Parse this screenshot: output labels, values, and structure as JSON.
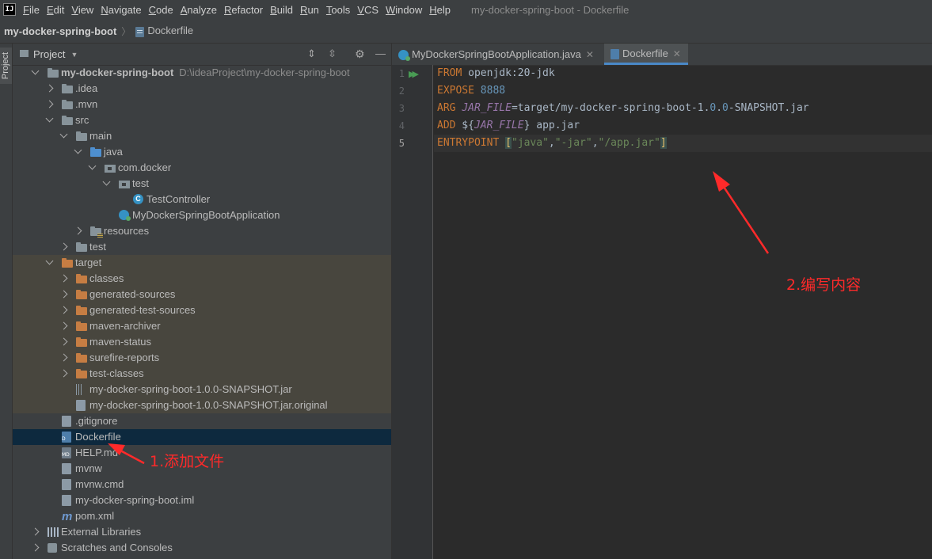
{
  "menu": {
    "logo": "IJ",
    "items": [
      "File",
      "Edit",
      "View",
      "Navigate",
      "Code",
      "Analyze",
      "Refactor",
      "Build",
      "Run",
      "Tools",
      "VCS",
      "Window",
      "Help"
    ],
    "window_title": "my-docker-spring-boot - Dockerfile"
  },
  "navbar": {
    "project": "my-docker-spring-boot",
    "file": "Dockerfile"
  },
  "side_tab": "Project",
  "project_panel": {
    "title": "Project"
  },
  "tree": [
    {
      "label": "my-docker-spring-boot",
      "path": "D:\\ideaProject\\my-docker-spring-boot",
      "level": 0,
      "arrow": "down",
      "icon": "module-folder-icon",
      "bold": true
    },
    {
      "label": ".idea",
      "level": 1,
      "arrow": "right",
      "icon": "folder-icon"
    },
    {
      "label": ".mvn",
      "level": 1,
      "arrow": "right",
      "icon": "folder-icon"
    },
    {
      "label": "src",
      "level": 1,
      "arrow": "down",
      "icon": "folder-icon"
    },
    {
      "label": "main",
      "level": 2,
      "arrow": "down",
      "icon": "folder-icon"
    },
    {
      "label": "java",
      "level": 3,
      "arrow": "down",
      "icon": "source-folder-icon"
    },
    {
      "label": "com.docker",
      "level": 4,
      "arrow": "down",
      "icon": "package-icon"
    },
    {
      "label": "test",
      "level": 5,
      "arrow": "down",
      "icon": "package-icon"
    },
    {
      "label": "TestController",
      "level": 6,
      "arrow": "",
      "icon": "class-icon"
    },
    {
      "label": "MyDockerSpringBootApplication",
      "level": 5,
      "arrow": "",
      "icon": "spring-app-class-icon"
    },
    {
      "label": "resources",
      "level": 3,
      "arrow": "right",
      "icon": "resources-folder-icon"
    },
    {
      "label": "test",
      "level": 2,
      "arrow": "right",
      "icon": "folder-icon"
    },
    {
      "label": "target",
      "level": 1,
      "arrow": "down",
      "icon": "excluded-folder-icon",
      "tinted": true
    },
    {
      "label": "classes",
      "level": 2,
      "arrow": "right",
      "icon": "excluded-folder-icon",
      "tinted": true
    },
    {
      "label": "generated-sources",
      "level": 2,
      "arrow": "right",
      "icon": "excluded-folder-icon",
      "tinted": true
    },
    {
      "label": "generated-test-sources",
      "level": 2,
      "arrow": "right",
      "icon": "excluded-folder-icon",
      "tinted": true
    },
    {
      "label": "maven-archiver",
      "level": 2,
      "arrow": "right",
      "icon": "excluded-folder-icon",
      "tinted": true
    },
    {
      "label": "maven-status",
      "level": 2,
      "arrow": "right",
      "icon": "excluded-folder-icon",
      "tinted": true
    },
    {
      "label": "surefire-reports",
      "level": 2,
      "arrow": "right",
      "icon": "excluded-folder-icon",
      "tinted": true
    },
    {
      "label": "test-classes",
      "level": 2,
      "arrow": "right",
      "icon": "excluded-folder-icon",
      "tinted": true
    },
    {
      "label": "my-docker-spring-boot-1.0.0-SNAPSHOT.jar",
      "level": 2,
      "arrow": "",
      "icon": "jar-icon",
      "tinted": true
    },
    {
      "label": "my-docker-spring-boot-1.0.0-SNAPSHOT.jar.original",
      "level": 2,
      "arrow": "",
      "icon": "file-icon",
      "tinted": true
    },
    {
      "label": ".gitignore",
      "level": 1,
      "arrow": "",
      "icon": "gitignore-icon"
    },
    {
      "label": "Dockerfile",
      "level": 1,
      "arrow": "",
      "icon": "dockerfile-icon",
      "selected": true
    },
    {
      "label": "HELP.md",
      "level": 1,
      "arrow": "",
      "icon": "markdown-icon"
    },
    {
      "label": "mvnw",
      "level": 1,
      "arrow": "",
      "icon": "file-icon"
    },
    {
      "label": "mvnw.cmd",
      "level": 1,
      "arrow": "",
      "icon": "file-icon"
    },
    {
      "label": "my-docker-spring-boot.iml",
      "level": 1,
      "arrow": "",
      "icon": "iml-icon"
    },
    {
      "label": "pom.xml",
      "level": 1,
      "arrow": "",
      "icon": "maven-icon"
    },
    {
      "label": "External Libraries",
      "level": 0,
      "arrow": "right",
      "icon": "libraries-icon"
    },
    {
      "label": "Scratches and Consoles",
      "level": 0,
      "arrow": "right",
      "icon": "scratches-icon"
    }
  ],
  "editor": {
    "tabs": [
      {
        "label": "MyDockerSpringBootApplication.java",
        "icon": "spring-app-class-icon",
        "active": false
      },
      {
        "label": "Dockerfile",
        "icon": "dockerfile-icon",
        "active": true
      }
    ],
    "line_numbers": [
      "1",
      "2",
      "3",
      "4",
      "5"
    ],
    "current_line": 5,
    "code_lines": [
      [
        {
          "t": "FROM",
          "c": "kw"
        },
        {
          "t": " openjdk:20-jdk",
          "c": ""
        }
      ],
      [
        {
          "t": "EXPOSE",
          "c": "kw"
        },
        {
          "t": " ",
          "c": ""
        },
        {
          "t": "8888",
          "c": "num"
        }
      ],
      [
        {
          "t": "ARG",
          "c": "kw"
        },
        {
          "t": " ",
          "c": ""
        },
        {
          "t": "JAR_FILE",
          "c": "var"
        },
        {
          "t": "=target/my-docker-spring-boot-1.",
          "c": ""
        },
        {
          "t": "0",
          "c": "num"
        },
        {
          "t": ".",
          "c": ""
        },
        {
          "t": "0",
          "c": "num"
        },
        {
          "t": "-SNAPSHOT.jar",
          "c": ""
        }
      ],
      [
        {
          "t": "ADD",
          "c": "kw"
        },
        {
          "t": " ${",
          "c": ""
        },
        {
          "t": "JAR_FILE",
          "c": "var"
        },
        {
          "t": "} app.jar",
          "c": ""
        }
      ],
      [
        {
          "t": "ENTRYPOINT",
          "c": "kw"
        },
        {
          "t": " ",
          "c": ""
        },
        {
          "t": "[",
          "c": "brk"
        },
        {
          "t": "\"java\"",
          "c": "str"
        },
        {
          "t": ",",
          "c": ""
        },
        {
          "t": "\"-jar\"",
          "c": "str"
        },
        {
          "t": ",",
          "c": ""
        },
        {
          "t": "\"/app.jar\"",
          "c": "str"
        },
        {
          "t": "]",
          "c": "brk"
        }
      ]
    ]
  },
  "annotations": {
    "step1": "1.添加文件",
    "step2": "2.编写内容",
    "color": "#ff2a2a"
  }
}
